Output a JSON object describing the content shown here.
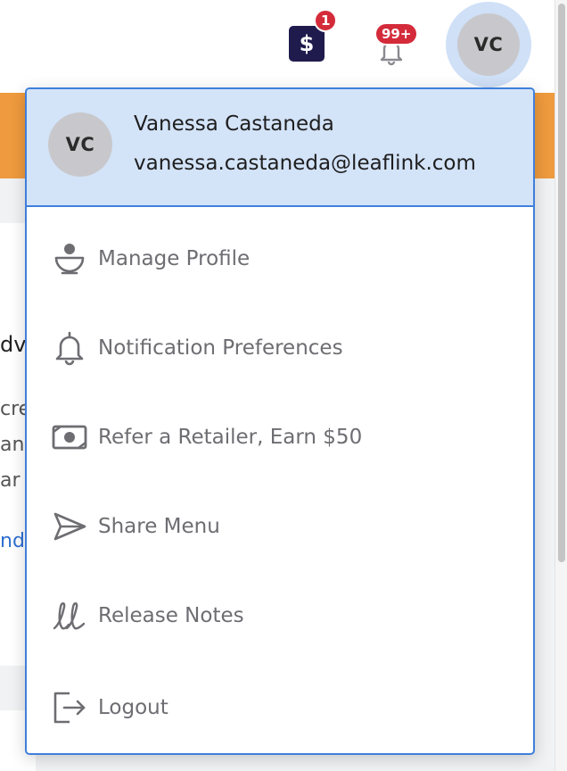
{
  "topbar": {
    "wallet_badge": "1",
    "notifications_badge": "99+",
    "wallet_symbol": "$",
    "avatar_initials": "VC"
  },
  "background": {
    "heading_fragment": "dv",
    "line1_fragment": "cre",
    "line2_fragment": "an",
    "line3_fragment": "ar",
    "link_fragment": "nd"
  },
  "user_menu": {
    "header": {
      "initials": "VC",
      "name": "Vanessa Castaneda",
      "email": "vanessa.castaneda@leaflink.com"
    },
    "items": [
      {
        "label": "Manage Profile",
        "icon": "profile-icon"
      },
      {
        "label": "Notification Preferences",
        "icon": "bell-icon"
      },
      {
        "label": "Refer a Retailer, Earn $50",
        "icon": "cash-icon"
      },
      {
        "label": "Share Menu",
        "icon": "send-icon"
      },
      {
        "label": "Release Notes",
        "icon": "release-notes-icon"
      },
      {
        "label": "Logout",
        "icon": "logout-icon"
      }
    ]
  },
  "colors": {
    "accent_border": "#3f7fdb",
    "header_bg": "#d3e3f8",
    "orange_band": "#ef9a3e",
    "badge_red": "#d42b3a",
    "wallet_bg": "#1f1b4d",
    "menu_text": "#6d6d72"
  }
}
